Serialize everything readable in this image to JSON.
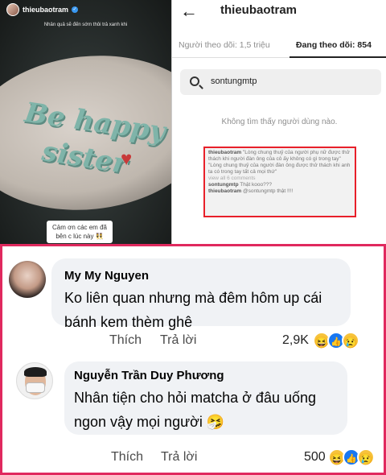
{
  "story": {
    "username": "thieubaotram",
    "caption": "Nhân quả sẽ đến sớm thôi trả xanh khi",
    "cake_line1": "Be happy",
    "cake_line2": "sister",
    "bubble_text": "Cảm ơn các em đã bên c lúc này 👯"
  },
  "profile": {
    "title": "thieubaotram",
    "tab_followers": "Người theo dõi: 1,5 triệu",
    "tab_following": "Đang theo dõi: 854",
    "search_value": "sontungmtp",
    "empty_text": "Không tìm thấy người dùng nào.",
    "evidence": {
      "user1": "thieubaotram",
      "comment1": "\"Lòng chung thuỷ của người phụ nữ được thử thách khi người đàn ông của cô ấy không có gì trong tay\"",
      "comment2": "\"Lòng chung thuỷ của người đàn ông được thử thách khi anh ta có trong tay tất cả mọi thứ\"",
      "view_all": "view all 6 comments",
      "user2": "sontungmtp",
      "reply2": "Thật kooo???",
      "user3": "thieubaotram",
      "reply3": "@sontungmtp thật !!!!"
    }
  },
  "comments": [
    {
      "name": "My My Nguyen",
      "text": "Ko liên quan nhưng mà đêm hôm up cái bánh kem thèm ghê",
      "like_label": "Thích",
      "reply_label": "Trả lời",
      "count": "2,9K",
      "reactions": [
        "haha-icon",
        "like-icon",
        "sad-icon"
      ]
    },
    {
      "name": "Nguyễn Trần Duy Phương",
      "text": "Nhân tiện cho hỏi matcha ở đâu uống ngon vậy mọi người 🤧",
      "like_label": "Thích",
      "reply_label": "Trả lời",
      "count": "500",
      "reactions": [
        "haha-icon",
        "like-icon",
        "sad-icon"
      ]
    }
  ],
  "colors": {
    "highlight_border": "#e0295e",
    "evidence_border": "#e8202a",
    "like_blue": "#1877f2"
  }
}
